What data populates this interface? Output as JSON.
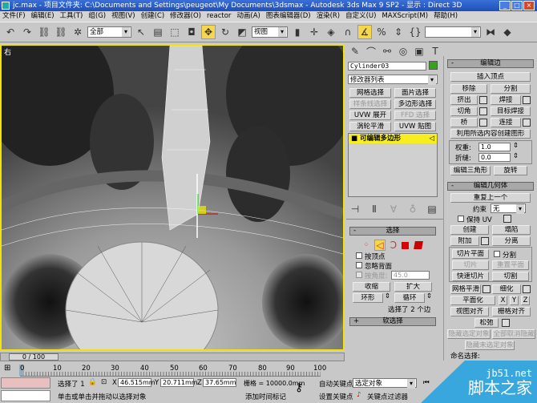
{
  "title": {
    "file": "jc.max",
    "project": "- 项目文件夹: C:\\Documents and Settings\\peugeot\\My Documents\\3dsmax",
    "app": "- Autodesk 3ds Max 9 SP2",
    "display": "- 显示 : Direct 3D"
  },
  "menu": [
    "文件(F)",
    "编辑(E)",
    "工具(T)",
    "组(G)",
    "视图(V)",
    "创建(C)",
    "修改器(O)",
    "reactor",
    "动画(A)",
    "图表编辑器(D)",
    "渲染(R)",
    "自定义(U)",
    "MAXScript(M)",
    "帮助(H)"
  ],
  "toolbar": {
    "selection_filter": "全部",
    "coord_system": "视图"
  },
  "viewport": {
    "label": "右"
  },
  "command_panel": {
    "object_name": "Cylinder03",
    "object_color": "#3aa020",
    "modifier_list": "修改器列表",
    "mod_buttons": [
      "网格选择",
      "面片选择",
      "样条线选择",
      "多边形选择",
      "UVW 展开",
      "FFD 选择",
      "涡轮平滑",
      "UVW 贴图"
    ],
    "stack_item": "可编辑多边形",
    "selection": {
      "title": "选择",
      "by_vertex": "按顶点",
      "ignore_backfacing": "忽略背面",
      "by_angle": "按角度:",
      "angle_value": "45.0",
      "shrink": "收缩",
      "grow": "扩大",
      "ring": "环形",
      "loop": "循环",
      "status": "选择了 2 个边"
    },
    "soft_selection": "软选择"
  },
  "edit_edges": {
    "title": "编辑边",
    "insert_vertex": "插入顶点",
    "remove": "移除",
    "split": "分割",
    "extrude": "挤出",
    "weld": "焊接",
    "chamfer": "切角",
    "target_weld": "目标焊接",
    "bridge": "桥",
    "connect": "连接",
    "create_shape": "利用所选内容创建图形",
    "weight_label": "权重:",
    "weight": "1.0",
    "crease_label": "折缝:",
    "crease": "0.0",
    "edit_tri": "编辑三角形",
    "turn": "旋转"
  },
  "edit_geometry": {
    "title": "编辑几何体",
    "repeat_last": "重复上一个",
    "constraints_label": "约束",
    "constraints": "无",
    "preserve_uv": "保持 UV",
    "create": "创建",
    "collapse": "塌陷",
    "attach": "附加",
    "detach": "分离",
    "slice_plane": "切片平面",
    "split": "分割",
    "slice": "切片",
    "reset_plane": "重置平面",
    "quickslice": "快速切片",
    "cut": "切割",
    "meshsmooth": "网格平滑",
    "tessellate": "细化",
    "make_planar": "平面化",
    "x": "X",
    "y": "Y",
    "z": "Z",
    "view_align": "视图对齐",
    "grid_align": "栅格对齐",
    "relax": "松弛",
    "hide_selected": "隐藏选定对象",
    "unhide_all": "全部取消隐藏",
    "hide_unselected": "隐藏未选定对象",
    "named_sel": "命名选择:"
  },
  "timeline": {
    "frame": "0 / 100",
    "ticks": [
      "0",
      "10",
      "20",
      "30",
      "40",
      "50",
      "60",
      "70",
      "80",
      "90",
      "100"
    ]
  },
  "status": {
    "selected": "选择了 1",
    "x": "46.515mm",
    "y": "20.711mm",
    "z": "37.65mm",
    "grid": "栅格 = 10000.0mm",
    "prompt": "单击或单击并拖动以选择对象",
    "add_time_tag": "添加时间标记",
    "auto_key": "自动关键点",
    "set_key": "设置关键点",
    "key_mode": "选定对象",
    "key_filters": "关键点过滤器"
  },
  "watermark": {
    "url": "jb51.net",
    "name": "脚本之家"
  }
}
